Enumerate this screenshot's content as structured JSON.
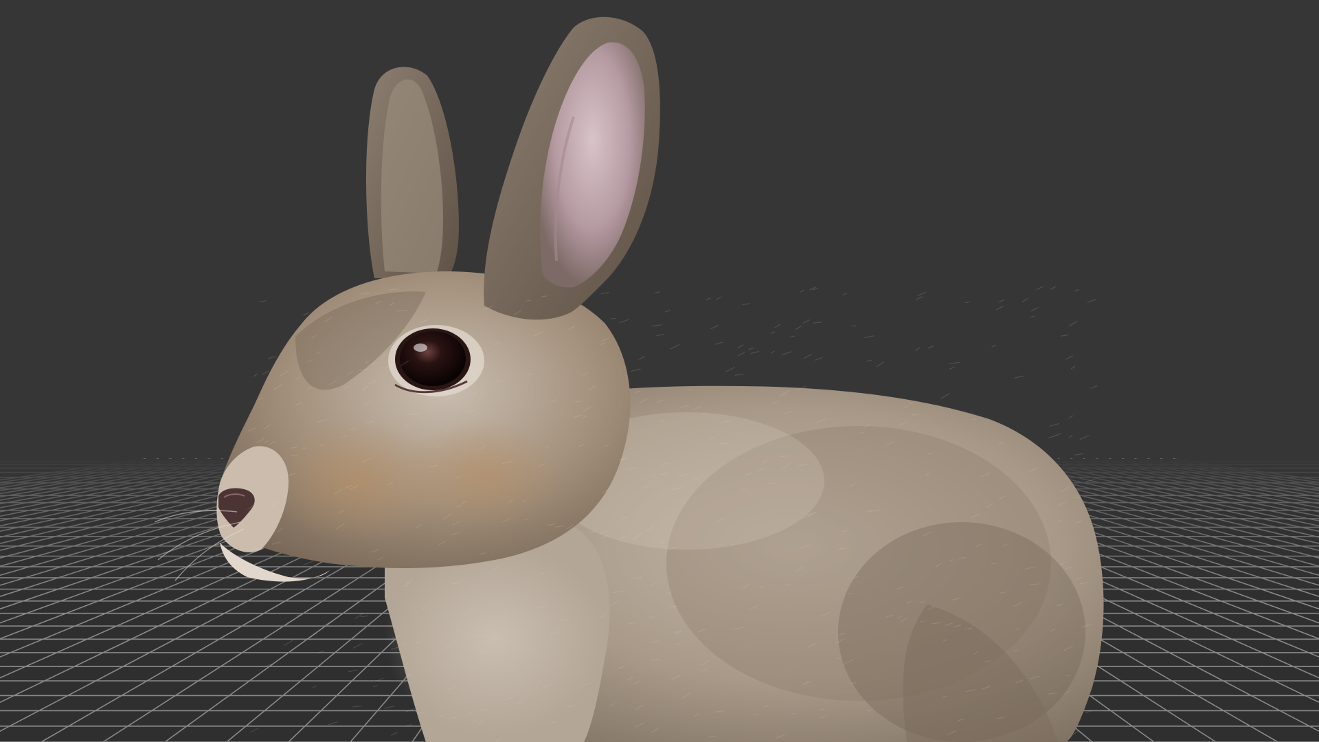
{
  "viewport": {
    "mode": "3d-model-preview",
    "background_color": "#363636",
    "grid": {
      "visible": true,
      "line_color": "#8a8a8a",
      "floor_color": "#2f2f2f"
    },
    "model": {
      "subject": "rabbit",
      "fur_color": "#a99a88",
      "ear_inner_color": "#b59aa2",
      "eye_color": "#1c0c0c"
    }
  }
}
